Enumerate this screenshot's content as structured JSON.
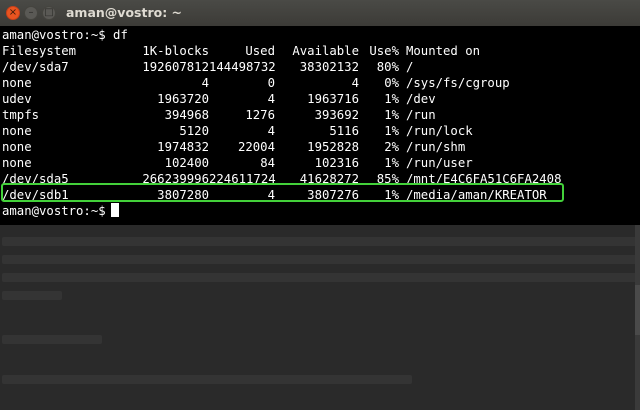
{
  "window": {
    "title": "aman@vostro: ~",
    "buttons": {
      "close": "×",
      "minimize": "–",
      "maximize": "□"
    }
  },
  "terminal": {
    "command_line": "aman@vostro:~$ df",
    "headers": [
      "Filesystem",
      "1K-blocks",
      "Used",
      "Available",
      "Use%",
      "Mounted on"
    ],
    "rows": [
      [
        "/dev/sda7",
        "192607812",
        "144498732",
        "38302132",
        "80%",
        "/"
      ],
      [
        "none",
        "4",
        "0",
        "4",
        "0%",
        "/sys/fs/cgroup"
      ],
      [
        "udev",
        "1963720",
        "4",
        "1963716",
        "1%",
        "/dev"
      ],
      [
        "tmpfs",
        "394968",
        "1276",
        "393692",
        "1%",
        "/run"
      ],
      [
        "none",
        "5120",
        "4",
        "5116",
        "1%",
        "/run/lock"
      ],
      [
        "none",
        "1974832",
        "22004",
        "1952828",
        "2%",
        "/run/shm"
      ],
      [
        "none",
        "102400",
        "84",
        "102316",
        "1%",
        "/run/user"
      ],
      [
        "/dev/sda5",
        "266239996",
        "224611724",
        "41628272",
        "85%",
        "/mnt/E4C6FA51C6FA2408"
      ],
      [
        "/dev/sdb1",
        "3807280",
        "4",
        "3807276",
        "1%",
        "/media/aman/KREATOR"
      ]
    ],
    "prompt": "aman@vostro:~$"
  },
  "colors": {
    "terminal_bg": "#000000",
    "terminal_text": "#ffffff",
    "highlight_border": "#43d13a",
    "close_button": "#e95420",
    "titlebar": "#3c3b37"
  }
}
